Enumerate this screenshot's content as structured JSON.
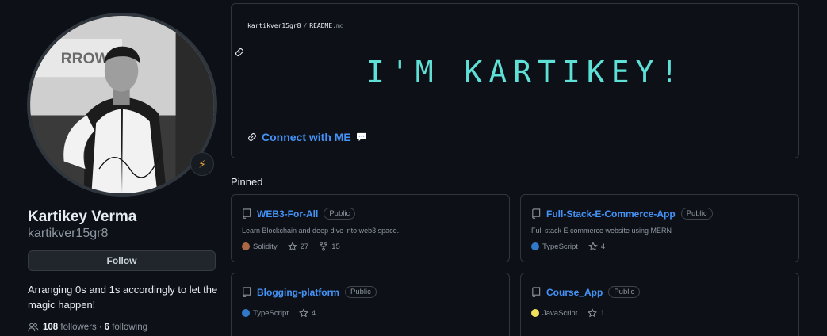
{
  "profile": {
    "name": "Kartikey Verma",
    "login": "kartikver15gr8",
    "follow_label": "Follow",
    "bio": "Arranging 0s and 1s accordingly to let the magic happen!",
    "followers_count": "108",
    "followers_label": "followers",
    "dot": "·",
    "following_count": "6",
    "following_label": "following",
    "status_emoji": "⚡",
    "photo_sign_text": "RROW"
  },
  "readme": {
    "owner": "kartikver15gr8",
    "separator": "/",
    "file": "README",
    "ext": ".md",
    "banner_text": "I'M KARTIKEY!",
    "connect_text": "Connect with ME",
    "connect_emoji_icon": "speech-balloon-icon"
  },
  "pinned": {
    "title": "Pinned",
    "repos": [
      {
        "name": "WEB3-For-All",
        "visibility": "Public",
        "description": "Learn Blockchain and deep dive into web3 space.",
        "language": "Solidity",
        "language_color": "#AA6746",
        "stars": "27",
        "forks": "15"
      },
      {
        "name": "Full-Stack-E-Commerce-App",
        "visibility": "Public",
        "description": "Full stack E commerce website using MERN",
        "language": "TypeScript",
        "language_color": "#3178C6",
        "stars": "4"
      },
      {
        "name": "Blogging-platform",
        "visibility": "Public",
        "description": "",
        "language": "TypeScript",
        "language_color": "#3178C6",
        "stars": "4"
      },
      {
        "name": "Course_App",
        "visibility": "Public",
        "description": "",
        "language": "JavaScript",
        "language_color": "#F1E05A",
        "stars": "1"
      }
    ]
  },
  "colors": {
    "background": "#0d1117",
    "accent_link": "#4493f8",
    "banner": "#5fe0d6",
    "border": "#30363d"
  }
}
